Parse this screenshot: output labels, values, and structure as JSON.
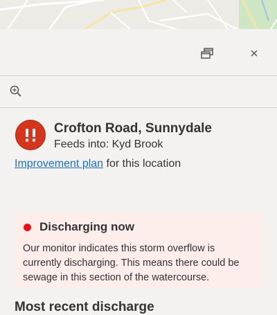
{
  "map": {
    "label": "Map"
  },
  "panel": {
    "restore_icon": "window-restore-icon",
    "close_icon": "close-icon",
    "zoom_icon": "zoom-in-icon"
  },
  "location": {
    "status_icon": "alert-exclamation-icon",
    "title": "Crofton Road, Sunnydale",
    "feeds_into": "Feeds into: Kyd Brook",
    "plan_link": "Improvement plan",
    "plan_suffix": " for this location"
  },
  "status": {
    "title": "Discharging now",
    "body": "Our monitor indicates this storm overflow is currently discharging. This means there could be sewage in this section of the watercourse.",
    "dot_color": "#e8101a",
    "background": "#fdeeec"
  },
  "next_section": {
    "heading": "Most recent discharge"
  }
}
